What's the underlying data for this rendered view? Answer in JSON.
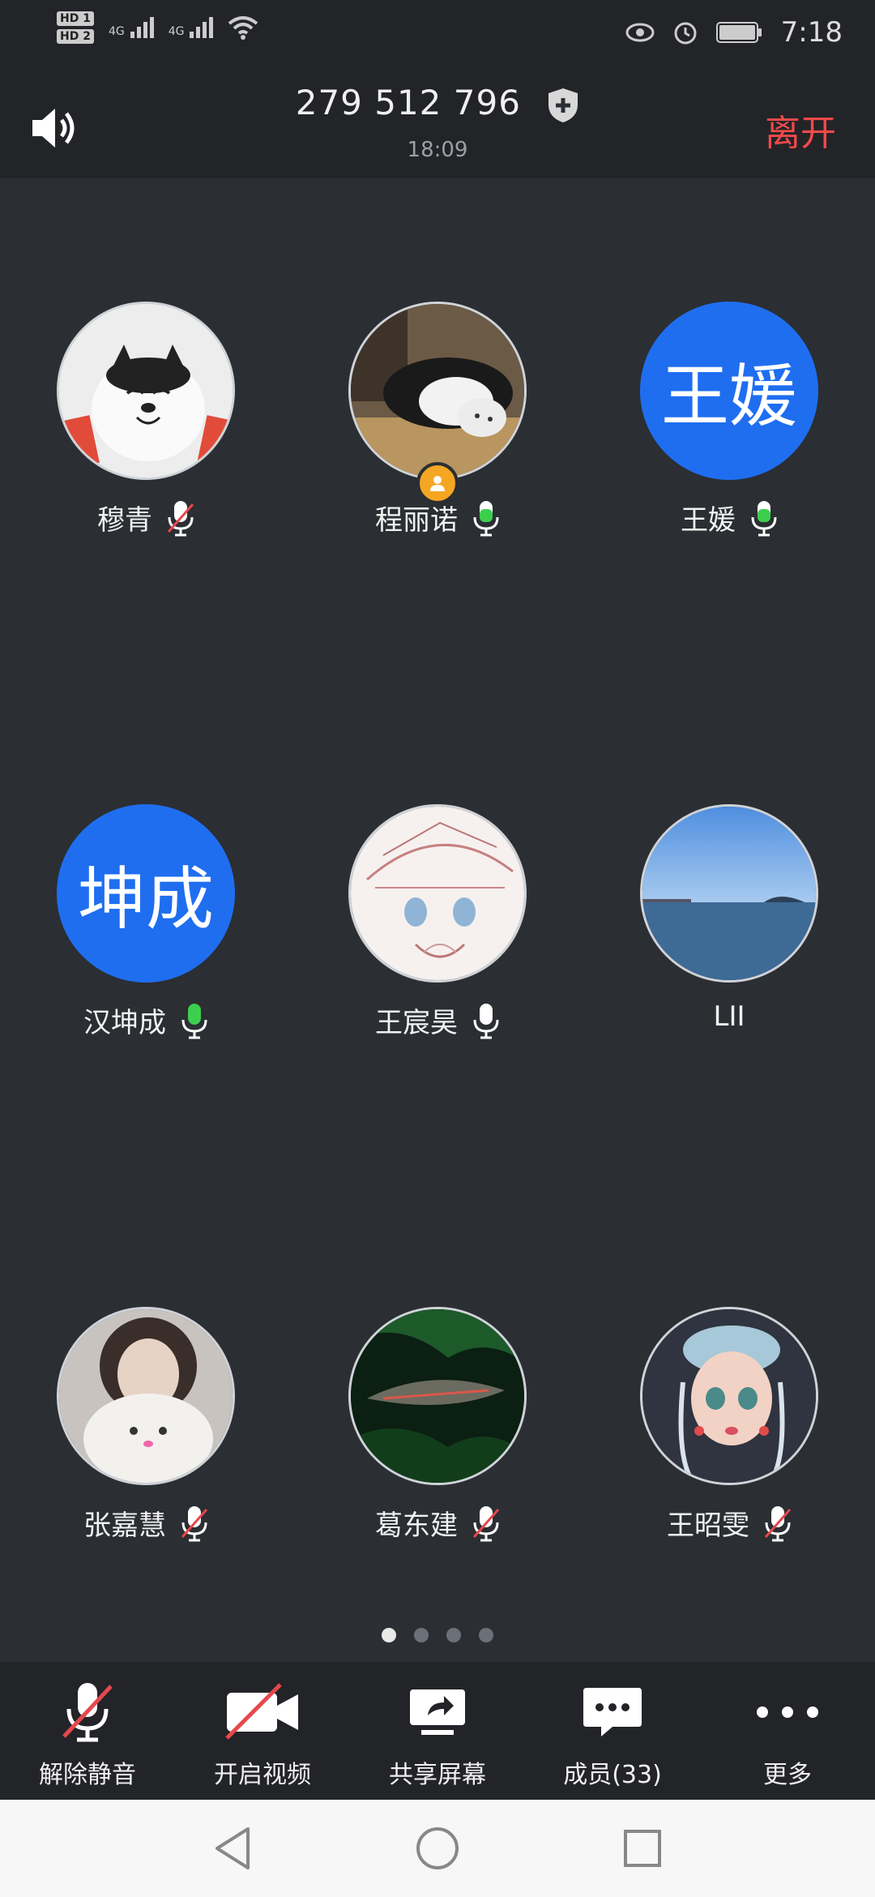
{
  "status_bar": {
    "hd1": "HD 1",
    "hd2": "HD 2",
    "net1": "4G",
    "net2": "4G",
    "time": "7:18"
  },
  "call": {
    "meeting_id": "279 512 796",
    "timer": "18:09",
    "leave_label": "离开"
  },
  "participants": [
    {
      "name": "穆青",
      "mic": "muted",
      "avatar": "photo-dog"
    },
    {
      "name": "程丽诺",
      "mic": "active",
      "avatar": "photo-cat",
      "host": true
    },
    {
      "name": "王媛",
      "mic": "active",
      "avatar_text": "王媛"
    },
    {
      "name": "汉坤成",
      "mic": "active",
      "avatar_text": "坤成"
    },
    {
      "name": "王宸昊",
      "mic": "on",
      "avatar": "photo-sketch"
    },
    {
      "name": "LII",
      "mic": "none",
      "avatar": "photo-sea"
    },
    {
      "name": "张嘉慧",
      "mic": "muted",
      "avatar": "photo-girl-cat"
    },
    {
      "name": "葛东建",
      "mic": "muted",
      "avatar": "photo-shark"
    },
    {
      "name": "王昭雯",
      "mic": "muted",
      "avatar": "photo-doll"
    }
  ],
  "pager": {
    "pages": 4,
    "current": 1
  },
  "toolbar": {
    "unmute": "解除静音",
    "video": "开启视频",
    "share": "共享屏幕",
    "members": "成员(33)",
    "more": "更多"
  },
  "colors": {
    "background": "#2b2e33",
    "bar": "#232428",
    "leave": "#f04a4a",
    "avatar_blue": "#1f6ef0",
    "mic_active": "#3ccf4e",
    "muted_red": "#e5484d",
    "host_badge": "#f5a623"
  }
}
